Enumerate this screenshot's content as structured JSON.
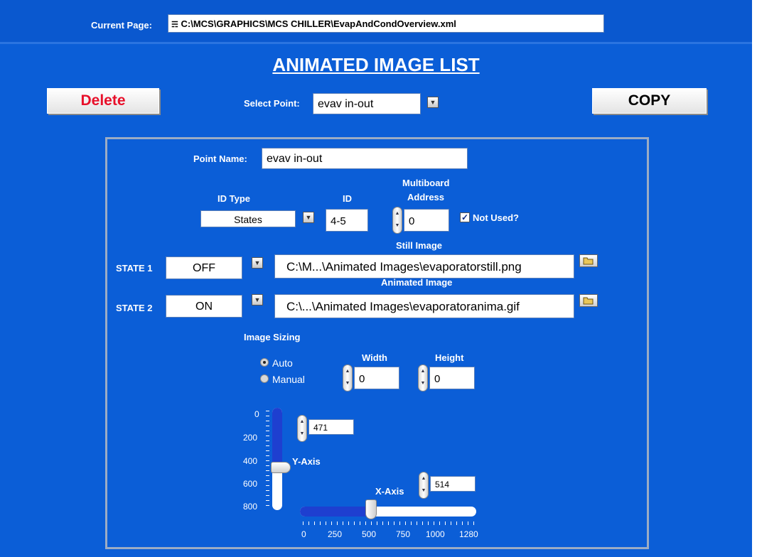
{
  "header": {
    "current_page_label": "Current Page:",
    "current_page_icon": "hierarchy-icon",
    "current_page_value": "C:\\MCS\\GRAPHICS\\MCS CHILLER\\EvapAndCondOverview.xml"
  },
  "title": "ANIMATED IMAGE LIST",
  "toolbar": {
    "delete_label": "Delete",
    "copy_label": "COPY",
    "select_point_label": "Select Point:",
    "select_point_value": "evav in-out"
  },
  "point": {
    "name_label": "Point Name:",
    "name_value": "evav in-out",
    "id_type_label": "ID Type",
    "id_type_value": "States",
    "id_label": "ID",
    "id_value": "4-5",
    "multiboard_label": "Multiboard",
    "address_label": "Address",
    "address_value": "0",
    "not_used_label": "Not Used?",
    "not_used_checked": true
  },
  "states": {
    "still_image_label": "Still Image",
    "animated_image_label": "Animated Image",
    "state1_label": "STATE 1",
    "state1_value": "OFF",
    "state1_path": "C:\\M...\\Animated Images\\evaporatorstill.png",
    "state2_label": "STATE 2",
    "state2_value": "ON",
    "state2_path": "C:\\...\\Animated Images\\evaporatoranima.gif"
  },
  "sizing": {
    "title": "Image Sizing",
    "auto_label": "Auto",
    "manual_label": "Manual",
    "selected": "Auto",
    "width_label": "Width",
    "width_value": "0",
    "height_label": "Height",
    "height_value": "0"
  },
  "position": {
    "y_axis_label": "Y-Axis",
    "y_value": "471",
    "y_scale": [
      "0",
      "200",
      "400",
      "600",
      "800"
    ],
    "x_axis_label": "X-Axis",
    "x_value": "514",
    "x_scale": [
      "0",
      "250",
      "500",
      "750",
      "1000",
      "1280"
    ]
  },
  "colors": {
    "background": "#0b5ed7",
    "delete_text": "#e8102a",
    "slider_fill": "#1e3fd0"
  }
}
